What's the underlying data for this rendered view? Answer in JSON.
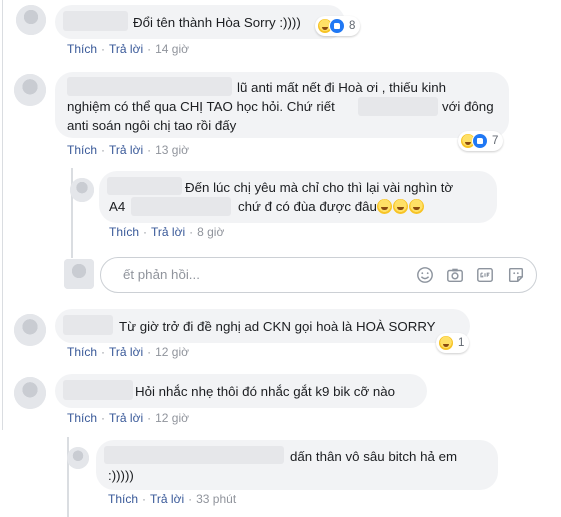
{
  "actions": {
    "like": "Thích",
    "reply": "Trả lời"
  },
  "comments": [
    {
      "text": "Đổi tên thành Hòa Sorry :))))",
      "time": "14 giờ",
      "reaction_count": "8"
    },
    {
      "line1": "lũ anti mất nết đi Hoà ơi , thiếu kinh",
      "line2_a": "nghiệm có thể qua CHỊ TAO học hỏi. Chứ riết",
      "line2_b": "với đông",
      "line3": "anti soán ngôi chị tao rồi đấy",
      "time": "13 giờ",
      "reaction_count": "7"
    },
    {
      "line1": "Đến lúc chị yêu mà chỉ cho thì lại vài nghìn tờ",
      "line2_a": "A4",
      "line2_b": "chứ đ có đùa được đâu",
      "time": "8 giờ"
    },
    {
      "text": "Từ giờ trở đi đề nghị ad CKN gọi hoà là HOÀ SORRY",
      "time": "12 giờ",
      "reaction_count": "1"
    },
    {
      "text": "Hỏi nhắc nhẹ thôi đó nhắc gắt k9 bik cỡ nào",
      "time": "12 giờ"
    },
    {
      "line1": "dấn thân vô sâu bitch hả em",
      "line2": ":)))))",
      "time": "33 phút"
    }
  ],
  "reply_input": {
    "placeholder": "ết phản hồi..."
  },
  "icons": [
    "haha-reaction-icon",
    "like-reaction-icon",
    "emoji-icon",
    "camera-icon",
    "gif-icon",
    "sticker-icon"
  ],
  "colors": {
    "link": "#385898",
    "bubble": "#f2f3f5",
    "meta": "#90949c",
    "like_blue": "#2078f4"
  }
}
